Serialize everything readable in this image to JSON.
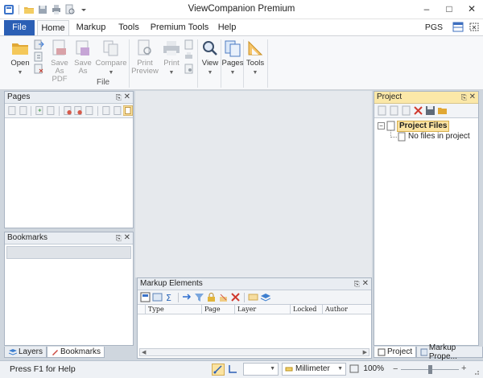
{
  "window": {
    "title": "ViewCompanion Premium"
  },
  "tabs": {
    "file": "File",
    "home": "Home",
    "markup": "Markup",
    "tools": "Tools",
    "premium_tools": "Premium Tools",
    "help": "Help",
    "pgs": "PGS"
  },
  "ribbon": {
    "open": "Open",
    "save_as_pdf": [
      "Save",
      "As PDF"
    ],
    "save_as": [
      "Save",
      "As"
    ],
    "compare": "Compare",
    "print_preview": [
      "Print",
      "Preview"
    ],
    "print": "Print",
    "view": "View",
    "pages": "Pages",
    "tools": "Tools",
    "file_group": "File"
  },
  "pages_panel": {
    "title": "Pages"
  },
  "bookmarks_panel": {
    "title": "Bookmarks"
  },
  "left_tabs": {
    "layers": "Layers",
    "bookmarks": "Bookmarks"
  },
  "project_panel": {
    "title": "Project",
    "tree_root": "Project Files",
    "tree_child": "No files in project"
  },
  "right_tabs": {
    "project": "Project",
    "markup_properties": "Markup Prope..."
  },
  "markup_panel": {
    "title": "Markup Elements",
    "columns": [
      "Type",
      "Page",
      "Layer",
      "Locked",
      "Author"
    ]
  },
  "status": {
    "help": "Press F1 for Help",
    "unit": "Millimeter",
    "zoom": "100%"
  },
  "colors": {
    "accent": "#2b5fb5",
    "highlight": "#fbe8a8",
    "doc_bg": "#e6e9ed"
  }
}
